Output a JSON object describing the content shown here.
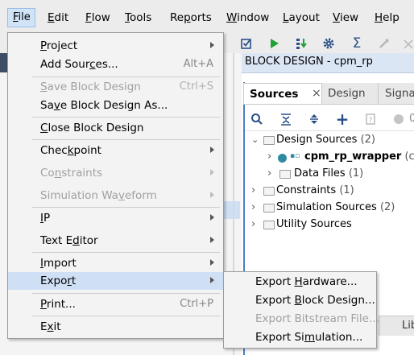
{
  "menubar": {
    "items": [
      {
        "label": "File",
        "mn": "F",
        "rest": "ile"
      },
      {
        "label": "Edit",
        "mn": "E",
        "rest": "dit"
      },
      {
        "label": "Flow",
        "mn": "F",
        "rest": "low"
      },
      {
        "label": "Tools",
        "mn": "T",
        "rest": "ools"
      },
      {
        "label": "Reports",
        "mn": "p",
        "pre": "Re",
        "rest": "orts"
      },
      {
        "label": "Window",
        "mn": "W",
        "rest": "indow"
      },
      {
        "label": "Layout",
        "mn": "L",
        "rest": "ayout"
      },
      {
        "label": "View",
        "mn": "V",
        "rest": "iew"
      },
      {
        "label": "Help",
        "mn": "H",
        "rest": "elp"
      }
    ]
  },
  "toolbar": {
    "icons": [
      "checkbox-icon",
      "run-icon",
      "program-device-icon",
      "settings-icon",
      "sigma-icon",
      "disabled-tool-icon",
      "more-icon"
    ],
    "colors": {
      "run": "#21a035",
      "gear": "#2a4f88"
    }
  },
  "block_design": {
    "title": "BLOCK DESIGN - cpm_rp"
  },
  "tabs": {
    "sources": "Sources",
    "close": "×",
    "design": "Design",
    "signals": "Signa"
  },
  "sources_toolbar": {
    "icons": [
      "search-icon",
      "collapse-all-icon",
      "expand-all-icon",
      "add-icon",
      "properties-icon",
      "status-dot-icon"
    ],
    "count_fragment": "0"
  },
  "tree": {
    "design_sources": {
      "label": "Design Sources",
      "count": "(2)"
    },
    "wrapper": {
      "label": "cpm_rp_wrapper",
      "suffix": "(cp"
    },
    "data_files": {
      "label": "Data Files",
      "count": "(1)"
    },
    "constraints": {
      "label": "Constraints",
      "count": "(1)"
    },
    "simulation": {
      "label": "Simulation Sources",
      "count": "(2)"
    },
    "utility": {
      "label": "Utility Sources"
    }
  },
  "file_menu": {
    "project": {
      "mn": "P",
      "rest": "roject"
    },
    "add_sources": {
      "pre": "Add Sour",
      "mn": "c",
      "rest": "es...",
      "shortcut": "Alt+A"
    },
    "save_bd": {
      "pre": "",
      "mn": "S",
      "rest": "ave Block Design",
      "shortcut": "Ctrl+S"
    },
    "save_bd_as": {
      "pre": "Sa",
      "mn": "v",
      "rest": "e Block Design As..."
    },
    "close_bd": {
      "pre": "",
      "mn": "C",
      "rest": "lose Block Design"
    },
    "checkpoint": {
      "pre": "Chec",
      "mn": "k",
      "rest": "point"
    },
    "constraints": {
      "pre": "Co",
      "mn": "n",
      "rest": "straints"
    },
    "sim_waveform": {
      "pre": "Simulation Wa",
      "mn": "v",
      "rest": "eform"
    },
    "ip": {
      "pre": "",
      "mn": "I",
      "rest": "P"
    },
    "text_editor": {
      "pre": "Text E",
      "mn": "d",
      "rest": "itor"
    },
    "import": {
      "pre": "",
      "mn": "I",
      "rest": "mport"
    },
    "export": {
      "pre": "Expo",
      "mn": "r",
      "rest": "t"
    },
    "print": {
      "pre": "",
      "mn": "P",
      "rest": "rint...",
      "shortcut": "Ctrl+P"
    },
    "exit": {
      "pre": "E",
      "mn": "x",
      "rest": "it"
    }
  },
  "export_menu": {
    "hardware": {
      "pre": "Export ",
      "mn": "H",
      "rest": "ardware..."
    },
    "block_design": {
      "pre": "Export ",
      "mn": "B",
      "rest": "lock Design..."
    },
    "bitstream": {
      "pre": "Export Bitstream File..."
    },
    "simulation": {
      "pre": "Export Si",
      "mn": "m",
      "rest": "ulation..."
    }
  },
  "lib_fragment": "Lib"
}
